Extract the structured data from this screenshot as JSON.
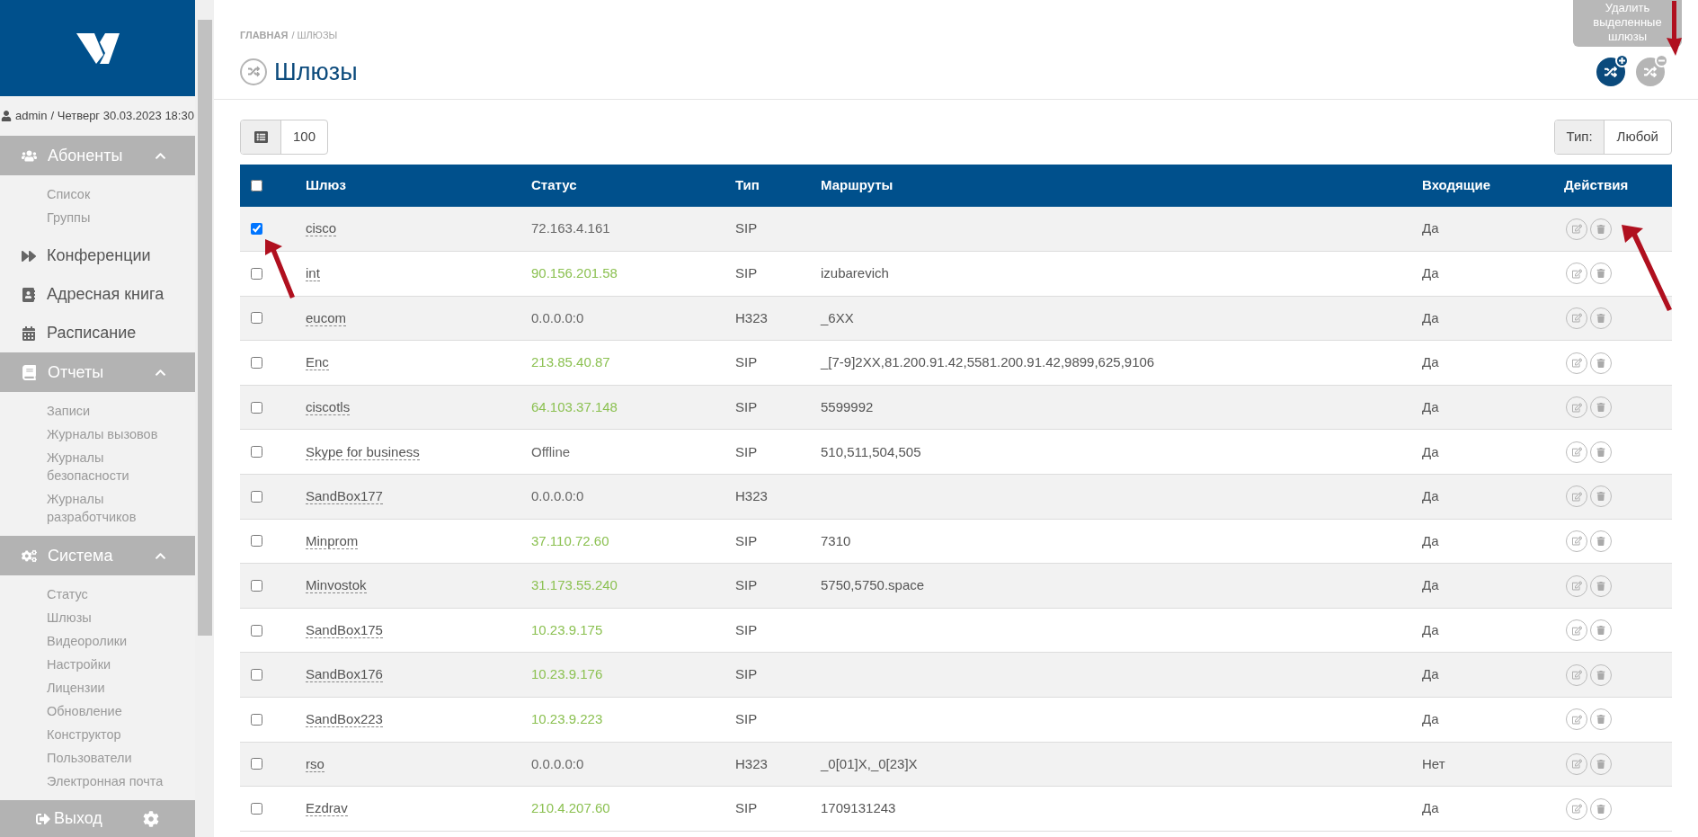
{
  "sidebar": {
    "user": "admin",
    "date": "/ Четверг 30.03.2023 18:30",
    "sections": [
      {
        "kind": "group",
        "label": "Абоненты",
        "expanded": true,
        "children": [
          {
            "label": "Список"
          },
          {
            "label": "Группы"
          }
        ]
      },
      {
        "kind": "link",
        "label": "Конференции"
      },
      {
        "kind": "link",
        "label": "Адресная книга"
      },
      {
        "kind": "link",
        "label": "Расписание"
      },
      {
        "kind": "group",
        "label": "Отчеты",
        "expanded": true,
        "children": [
          {
            "label": "Записи"
          },
          {
            "label": "Журналы вызовов"
          },
          {
            "label": "Журналы безопасности"
          },
          {
            "label": "Журналы разработчиков"
          }
        ]
      },
      {
        "kind": "group",
        "label": "Система",
        "expanded": true,
        "children": [
          {
            "label": "Статус"
          },
          {
            "label": "Шлюзы"
          },
          {
            "label": "Видеоролики"
          },
          {
            "label": "Настройки"
          },
          {
            "label": "Лицензии"
          },
          {
            "label": "Обновление"
          },
          {
            "label": "Конструктор"
          },
          {
            "label": "Пользователи"
          },
          {
            "label": "Электронная почта"
          }
        ]
      }
    ],
    "logout": "Выход"
  },
  "breadcrumb": {
    "home": "ГЛАВНАЯ",
    "current": "/ ШЛЮЗЫ"
  },
  "title": "Шлюзы",
  "tooltip": "Удалить выделенные шлюзы",
  "page_size": "100",
  "type_filter": {
    "label": "Тип:",
    "value": "Любой"
  },
  "table": {
    "columns": [
      "Шлюз",
      "Статус",
      "Тип",
      "Маршруты",
      "Входящие",
      "Действия"
    ],
    "all_checked": false,
    "rows": [
      {
        "checked": true,
        "name": "cisco",
        "status": "72.163.4.161",
        "online": false,
        "type": "SIP",
        "routes": "",
        "incoming": "Да"
      },
      {
        "checked": false,
        "name": "int",
        "status": "90.156.201.58",
        "online": true,
        "type": "SIP",
        "routes": "izubarevich",
        "incoming": "Да"
      },
      {
        "checked": false,
        "name": "eucom",
        "status": "0.0.0.0:0",
        "online": false,
        "type": "H323",
        "routes": "_6XX",
        "incoming": "Да"
      },
      {
        "checked": false,
        "name": "Enc",
        "status": "213.85.40.87",
        "online": true,
        "type": "SIP",
        "routes": "_[7-9]2XX,81.200.91.42,5581.200.91.42,9899,625,9106",
        "incoming": "Да"
      },
      {
        "checked": false,
        "name": "ciscotls",
        "status": "64.103.37.148",
        "online": true,
        "type": "SIP",
        "routes": "5599992",
        "incoming": "Да"
      },
      {
        "checked": false,
        "name": "Skype for business",
        "status": "Offline",
        "online": false,
        "type": "SIP",
        "routes": "510,511,504,505",
        "incoming": "Да"
      },
      {
        "checked": false,
        "name": "SandBox177",
        "status": "0.0.0.0:0",
        "online": false,
        "type": "H323",
        "routes": "",
        "incoming": "Да"
      },
      {
        "checked": false,
        "name": "Minprom",
        "status": "37.110.72.60",
        "online": true,
        "type": "SIP",
        "routes": "7310",
        "incoming": "Да"
      },
      {
        "checked": false,
        "name": "Minvostok",
        "status": "31.173.55.240",
        "online": true,
        "type": "SIP",
        "routes": "5750,5750.space",
        "incoming": "Да"
      },
      {
        "checked": false,
        "name": "SandBox175",
        "status": "10.23.9.175",
        "online": true,
        "type": "SIP",
        "routes": "",
        "incoming": "Да"
      },
      {
        "checked": false,
        "name": "SandBox176",
        "status": "10.23.9.176",
        "online": true,
        "type": "SIP",
        "routes": "",
        "incoming": "Да"
      },
      {
        "checked": false,
        "name": "SandBox223",
        "status": "10.23.9.223",
        "online": true,
        "type": "SIP",
        "routes": "",
        "incoming": "Да"
      },
      {
        "checked": false,
        "name": "rso",
        "status": "0.0.0.0:0",
        "online": false,
        "type": "H323",
        "routes": "_0[01]X,_0[23]X",
        "incoming": "Нет"
      },
      {
        "checked": false,
        "name": "Ezdrav",
        "status": "210.4.207.60",
        "online": true,
        "type": "SIP",
        "routes": "1709131243",
        "incoming": "Да"
      }
    ]
  }
}
